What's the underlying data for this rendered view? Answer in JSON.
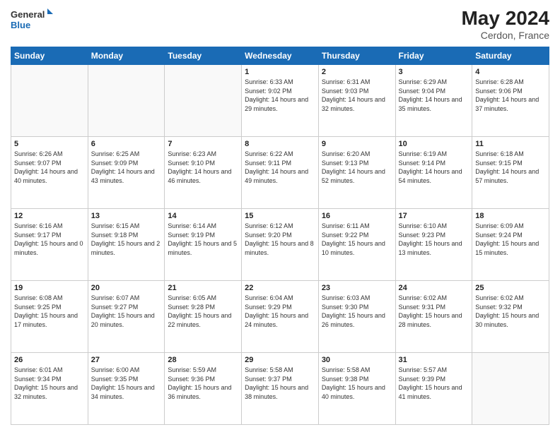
{
  "header": {
    "logo_general": "General",
    "logo_blue": "Blue",
    "month_year": "May 2024",
    "location": "Cerdon, France"
  },
  "days_of_week": [
    "Sunday",
    "Monday",
    "Tuesday",
    "Wednesday",
    "Thursday",
    "Friday",
    "Saturday"
  ],
  "weeks": [
    [
      {
        "day": "",
        "info": ""
      },
      {
        "day": "",
        "info": ""
      },
      {
        "day": "",
        "info": ""
      },
      {
        "day": "1",
        "info": "Sunrise: 6:33 AM\nSunset: 9:02 PM\nDaylight: 14 hours\nand 29 minutes."
      },
      {
        "day": "2",
        "info": "Sunrise: 6:31 AM\nSunset: 9:03 PM\nDaylight: 14 hours\nand 32 minutes."
      },
      {
        "day": "3",
        "info": "Sunrise: 6:29 AM\nSunset: 9:04 PM\nDaylight: 14 hours\nand 35 minutes."
      },
      {
        "day": "4",
        "info": "Sunrise: 6:28 AM\nSunset: 9:06 PM\nDaylight: 14 hours\nand 37 minutes."
      }
    ],
    [
      {
        "day": "5",
        "info": "Sunrise: 6:26 AM\nSunset: 9:07 PM\nDaylight: 14 hours\nand 40 minutes."
      },
      {
        "day": "6",
        "info": "Sunrise: 6:25 AM\nSunset: 9:09 PM\nDaylight: 14 hours\nand 43 minutes."
      },
      {
        "day": "7",
        "info": "Sunrise: 6:23 AM\nSunset: 9:10 PM\nDaylight: 14 hours\nand 46 minutes."
      },
      {
        "day": "8",
        "info": "Sunrise: 6:22 AM\nSunset: 9:11 PM\nDaylight: 14 hours\nand 49 minutes."
      },
      {
        "day": "9",
        "info": "Sunrise: 6:20 AM\nSunset: 9:13 PM\nDaylight: 14 hours\nand 52 minutes."
      },
      {
        "day": "10",
        "info": "Sunrise: 6:19 AM\nSunset: 9:14 PM\nDaylight: 14 hours\nand 54 minutes."
      },
      {
        "day": "11",
        "info": "Sunrise: 6:18 AM\nSunset: 9:15 PM\nDaylight: 14 hours\nand 57 minutes."
      }
    ],
    [
      {
        "day": "12",
        "info": "Sunrise: 6:16 AM\nSunset: 9:17 PM\nDaylight: 15 hours\nand 0 minutes."
      },
      {
        "day": "13",
        "info": "Sunrise: 6:15 AM\nSunset: 9:18 PM\nDaylight: 15 hours\nand 2 minutes."
      },
      {
        "day": "14",
        "info": "Sunrise: 6:14 AM\nSunset: 9:19 PM\nDaylight: 15 hours\nand 5 minutes."
      },
      {
        "day": "15",
        "info": "Sunrise: 6:12 AM\nSunset: 9:20 PM\nDaylight: 15 hours\nand 8 minutes."
      },
      {
        "day": "16",
        "info": "Sunrise: 6:11 AM\nSunset: 9:22 PM\nDaylight: 15 hours\nand 10 minutes."
      },
      {
        "day": "17",
        "info": "Sunrise: 6:10 AM\nSunset: 9:23 PM\nDaylight: 15 hours\nand 13 minutes."
      },
      {
        "day": "18",
        "info": "Sunrise: 6:09 AM\nSunset: 9:24 PM\nDaylight: 15 hours\nand 15 minutes."
      }
    ],
    [
      {
        "day": "19",
        "info": "Sunrise: 6:08 AM\nSunset: 9:25 PM\nDaylight: 15 hours\nand 17 minutes."
      },
      {
        "day": "20",
        "info": "Sunrise: 6:07 AM\nSunset: 9:27 PM\nDaylight: 15 hours\nand 20 minutes."
      },
      {
        "day": "21",
        "info": "Sunrise: 6:05 AM\nSunset: 9:28 PM\nDaylight: 15 hours\nand 22 minutes."
      },
      {
        "day": "22",
        "info": "Sunrise: 6:04 AM\nSunset: 9:29 PM\nDaylight: 15 hours\nand 24 minutes."
      },
      {
        "day": "23",
        "info": "Sunrise: 6:03 AM\nSunset: 9:30 PM\nDaylight: 15 hours\nand 26 minutes."
      },
      {
        "day": "24",
        "info": "Sunrise: 6:02 AM\nSunset: 9:31 PM\nDaylight: 15 hours\nand 28 minutes."
      },
      {
        "day": "25",
        "info": "Sunrise: 6:02 AM\nSunset: 9:32 PM\nDaylight: 15 hours\nand 30 minutes."
      }
    ],
    [
      {
        "day": "26",
        "info": "Sunrise: 6:01 AM\nSunset: 9:34 PM\nDaylight: 15 hours\nand 32 minutes."
      },
      {
        "day": "27",
        "info": "Sunrise: 6:00 AM\nSunset: 9:35 PM\nDaylight: 15 hours\nand 34 minutes."
      },
      {
        "day": "28",
        "info": "Sunrise: 5:59 AM\nSunset: 9:36 PM\nDaylight: 15 hours\nand 36 minutes."
      },
      {
        "day": "29",
        "info": "Sunrise: 5:58 AM\nSunset: 9:37 PM\nDaylight: 15 hours\nand 38 minutes."
      },
      {
        "day": "30",
        "info": "Sunrise: 5:58 AM\nSunset: 9:38 PM\nDaylight: 15 hours\nand 40 minutes."
      },
      {
        "day": "31",
        "info": "Sunrise: 5:57 AM\nSunset: 9:39 PM\nDaylight: 15 hours\nand 41 minutes."
      },
      {
        "day": "",
        "info": ""
      }
    ]
  ]
}
